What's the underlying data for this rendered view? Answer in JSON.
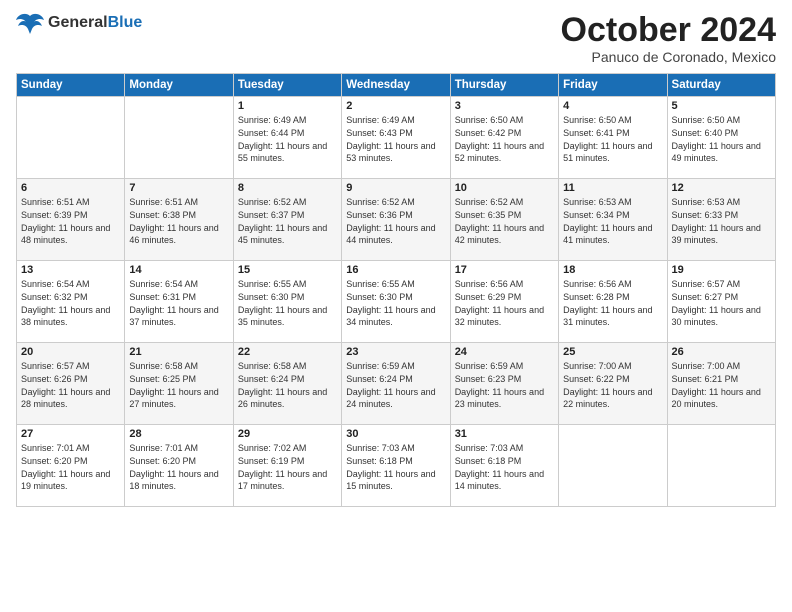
{
  "logo": {
    "general": "General",
    "blue": "Blue"
  },
  "header": {
    "month": "October 2024",
    "location": "Panuco de Coronado, Mexico"
  },
  "weekdays": [
    "Sunday",
    "Monday",
    "Tuesday",
    "Wednesday",
    "Thursday",
    "Friday",
    "Saturday"
  ],
  "weeks": [
    [
      {
        "day": "",
        "info": ""
      },
      {
        "day": "",
        "info": ""
      },
      {
        "day": "1",
        "info": "Sunrise: 6:49 AM\nSunset: 6:44 PM\nDaylight: 11 hours and 55 minutes."
      },
      {
        "day": "2",
        "info": "Sunrise: 6:49 AM\nSunset: 6:43 PM\nDaylight: 11 hours and 53 minutes."
      },
      {
        "day": "3",
        "info": "Sunrise: 6:50 AM\nSunset: 6:42 PM\nDaylight: 11 hours and 52 minutes."
      },
      {
        "day": "4",
        "info": "Sunrise: 6:50 AM\nSunset: 6:41 PM\nDaylight: 11 hours and 51 minutes."
      },
      {
        "day": "5",
        "info": "Sunrise: 6:50 AM\nSunset: 6:40 PM\nDaylight: 11 hours and 49 minutes."
      }
    ],
    [
      {
        "day": "6",
        "info": "Sunrise: 6:51 AM\nSunset: 6:39 PM\nDaylight: 11 hours and 48 minutes."
      },
      {
        "day": "7",
        "info": "Sunrise: 6:51 AM\nSunset: 6:38 PM\nDaylight: 11 hours and 46 minutes."
      },
      {
        "day": "8",
        "info": "Sunrise: 6:52 AM\nSunset: 6:37 PM\nDaylight: 11 hours and 45 minutes."
      },
      {
        "day": "9",
        "info": "Sunrise: 6:52 AM\nSunset: 6:36 PM\nDaylight: 11 hours and 44 minutes."
      },
      {
        "day": "10",
        "info": "Sunrise: 6:52 AM\nSunset: 6:35 PM\nDaylight: 11 hours and 42 minutes."
      },
      {
        "day": "11",
        "info": "Sunrise: 6:53 AM\nSunset: 6:34 PM\nDaylight: 11 hours and 41 minutes."
      },
      {
        "day": "12",
        "info": "Sunrise: 6:53 AM\nSunset: 6:33 PM\nDaylight: 11 hours and 39 minutes."
      }
    ],
    [
      {
        "day": "13",
        "info": "Sunrise: 6:54 AM\nSunset: 6:32 PM\nDaylight: 11 hours and 38 minutes."
      },
      {
        "day": "14",
        "info": "Sunrise: 6:54 AM\nSunset: 6:31 PM\nDaylight: 11 hours and 37 minutes."
      },
      {
        "day": "15",
        "info": "Sunrise: 6:55 AM\nSunset: 6:30 PM\nDaylight: 11 hours and 35 minutes."
      },
      {
        "day": "16",
        "info": "Sunrise: 6:55 AM\nSunset: 6:30 PM\nDaylight: 11 hours and 34 minutes."
      },
      {
        "day": "17",
        "info": "Sunrise: 6:56 AM\nSunset: 6:29 PM\nDaylight: 11 hours and 32 minutes."
      },
      {
        "day": "18",
        "info": "Sunrise: 6:56 AM\nSunset: 6:28 PM\nDaylight: 11 hours and 31 minutes."
      },
      {
        "day": "19",
        "info": "Sunrise: 6:57 AM\nSunset: 6:27 PM\nDaylight: 11 hours and 30 minutes."
      }
    ],
    [
      {
        "day": "20",
        "info": "Sunrise: 6:57 AM\nSunset: 6:26 PM\nDaylight: 11 hours and 28 minutes."
      },
      {
        "day": "21",
        "info": "Sunrise: 6:58 AM\nSunset: 6:25 PM\nDaylight: 11 hours and 27 minutes."
      },
      {
        "day": "22",
        "info": "Sunrise: 6:58 AM\nSunset: 6:24 PM\nDaylight: 11 hours and 26 minutes."
      },
      {
        "day": "23",
        "info": "Sunrise: 6:59 AM\nSunset: 6:24 PM\nDaylight: 11 hours and 24 minutes."
      },
      {
        "day": "24",
        "info": "Sunrise: 6:59 AM\nSunset: 6:23 PM\nDaylight: 11 hours and 23 minutes."
      },
      {
        "day": "25",
        "info": "Sunrise: 7:00 AM\nSunset: 6:22 PM\nDaylight: 11 hours and 22 minutes."
      },
      {
        "day": "26",
        "info": "Sunrise: 7:00 AM\nSunset: 6:21 PM\nDaylight: 11 hours and 20 minutes."
      }
    ],
    [
      {
        "day": "27",
        "info": "Sunrise: 7:01 AM\nSunset: 6:20 PM\nDaylight: 11 hours and 19 minutes."
      },
      {
        "day": "28",
        "info": "Sunrise: 7:01 AM\nSunset: 6:20 PM\nDaylight: 11 hours and 18 minutes."
      },
      {
        "day": "29",
        "info": "Sunrise: 7:02 AM\nSunset: 6:19 PM\nDaylight: 11 hours and 17 minutes."
      },
      {
        "day": "30",
        "info": "Sunrise: 7:03 AM\nSunset: 6:18 PM\nDaylight: 11 hours and 15 minutes."
      },
      {
        "day": "31",
        "info": "Sunrise: 7:03 AM\nSunset: 6:18 PM\nDaylight: 11 hours and 14 minutes."
      },
      {
        "day": "",
        "info": ""
      },
      {
        "day": "",
        "info": ""
      }
    ]
  ]
}
